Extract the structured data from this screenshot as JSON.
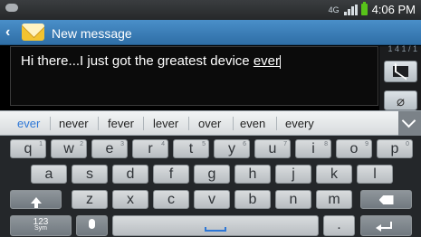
{
  "status": {
    "network": "4G",
    "time": "4:06 PM"
  },
  "header": {
    "title": "New message"
  },
  "message": {
    "text_before": "Hi there...I just got the greatest device ",
    "underlined_word": "ever"
  },
  "suggestions": [
    "ever",
    "never",
    "fever",
    "lever",
    "over",
    "even",
    "every"
  ],
  "keyboard": {
    "row1": [
      {
        "key": "q",
        "hint": "1"
      },
      {
        "key": "w",
        "hint": "2"
      },
      {
        "key": "e",
        "hint": "3"
      },
      {
        "key": "r",
        "hint": "4"
      },
      {
        "key": "t",
        "hint": "5"
      },
      {
        "key": "y",
        "hint": "6"
      },
      {
        "key": "u",
        "hint": "7"
      },
      {
        "key": "i",
        "hint": "8"
      },
      {
        "key": "o",
        "hint": "9"
      },
      {
        "key": "p",
        "hint": "0"
      }
    ],
    "row2": [
      "a",
      "s",
      "d",
      "f",
      "g",
      "h",
      "j",
      "k",
      "l"
    ],
    "row3": [
      "z",
      "x",
      "c",
      "v",
      "b",
      "n",
      "m"
    ],
    "sym_label": "123",
    "sym_sub": "Sym",
    "period": "."
  },
  "colors": {
    "header": "#3b7fbb",
    "accent": "#2d77d6",
    "battery": "#58c21a"
  }
}
